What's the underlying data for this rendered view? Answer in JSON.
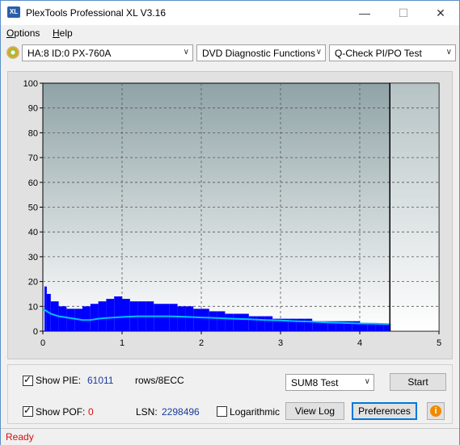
{
  "window": {
    "title": "PlexTools Professional XL V3.16",
    "icon_text": "XL"
  },
  "menu": [
    {
      "label": "Options",
      "mnemonic": "O",
      "rest": "ptions"
    },
    {
      "label": "Help",
      "mnemonic": "H",
      "rest": "elp"
    }
  ],
  "toolbar": {
    "drive": "HA:8 ID:0  PX-760A",
    "function": "DVD Diagnostic Functions",
    "test": "Q-Check PI/PO Test"
  },
  "chart_data": {
    "type": "bar",
    "y_ticks": [
      "100",
      "90",
      "80",
      "70",
      "60",
      "50",
      "40",
      "30",
      "20",
      "10",
      "0"
    ],
    "x_ticks": [
      "0",
      "1",
      "2",
      "3",
      "4",
      "5"
    ],
    "ylim": [
      0,
      100
    ],
    "xlim": [
      0,
      5
    ],
    "grid": true,
    "end_marker_x": 4.38,
    "series": [
      {
        "color": "#0000ff",
        "style": "bars",
        "points": [
          [
            0.02,
            18
          ],
          [
            0.05,
            15
          ],
          [
            0.1,
            12
          ],
          [
            0.2,
            10
          ],
          [
            0.3,
            9
          ],
          [
            0.4,
            9
          ],
          [
            0.5,
            10
          ],
          [
            0.6,
            11
          ],
          [
            0.7,
            12
          ],
          [
            0.8,
            13
          ],
          [
            0.9,
            14
          ],
          [
            1.0,
            13
          ],
          [
            1.1,
            12
          ],
          [
            1.2,
            12
          ],
          [
            1.3,
            12
          ],
          [
            1.4,
            11
          ],
          [
            1.5,
            11
          ],
          [
            1.6,
            11
          ],
          [
            1.7,
            10
          ],
          [
            1.8,
            10
          ],
          [
            1.9,
            9
          ],
          [
            2.0,
            9
          ],
          [
            2.1,
            8
          ],
          [
            2.2,
            8
          ],
          [
            2.3,
            7
          ],
          [
            2.4,
            7
          ],
          [
            2.5,
            7
          ],
          [
            2.6,
            6
          ],
          [
            2.7,
            6
          ],
          [
            2.8,
            6
          ],
          [
            2.9,
            5
          ],
          [
            3.0,
            5
          ],
          [
            3.1,
            5
          ],
          [
            3.2,
            5
          ],
          [
            3.3,
            5
          ],
          [
            3.4,
            4
          ],
          [
            3.5,
            4
          ],
          [
            3.6,
            4
          ],
          [
            3.7,
            4
          ],
          [
            3.8,
            4
          ],
          [
            3.9,
            4
          ],
          [
            4.0,
            3
          ],
          [
            4.1,
            3
          ],
          [
            4.2,
            3
          ],
          [
            4.3,
            3
          ],
          [
            4.38,
            3
          ]
        ]
      },
      {
        "color": "#00c0ff",
        "style": "line",
        "points": [
          [
            0.0,
            9
          ],
          [
            0.1,
            7
          ],
          [
            0.2,
            6
          ],
          [
            0.3,
            5.5
          ],
          [
            0.4,
            5
          ],
          [
            0.5,
            4.5
          ],
          [
            0.6,
            4.5
          ],
          [
            0.7,
            5
          ],
          [
            0.8,
            5.3
          ],
          [
            1.0,
            5.7
          ],
          [
            1.2,
            6
          ],
          [
            1.4,
            6
          ],
          [
            1.6,
            6
          ],
          [
            1.8,
            5.8
          ],
          [
            2.0,
            5.5
          ],
          [
            2.2,
            5.3
          ],
          [
            2.4,
            5
          ],
          [
            2.6,
            4.8
          ],
          [
            2.8,
            4.5
          ],
          [
            3.0,
            4.3
          ],
          [
            3.2,
            4
          ],
          [
            3.4,
            3.8
          ],
          [
            3.6,
            3.5
          ],
          [
            3.8,
            3.3
          ],
          [
            4.0,
            3.1
          ],
          [
            4.2,
            3
          ],
          [
            4.38,
            2.8
          ]
        ]
      }
    ]
  },
  "controls": {
    "show_pie_label": "Show PIE:",
    "pie_value": "61011",
    "rows_label": "rows/8ECC",
    "show_pof_label": "Show POF:",
    "pof_value": "0",
    "lsn_label": "LSN:",
    "lsn_value": "2298496",
    "logarithmic_label": "Logarithmic",
    "sum_select": "SUM8 Test",
    "start_button": "Start",
    "viewlog_button": "View Log",
    "preferences_button": "Preferences",
    "info_icon": "i"
  },
  "status": {
    "text": "Ready",
    "color": "#d01010"
  }
}
